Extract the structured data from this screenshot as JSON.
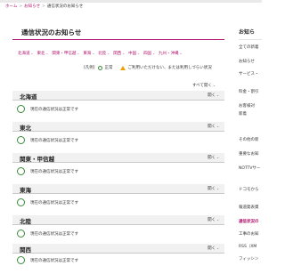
{
  "breadcrumb": {
    "home": "ホーム",
    "sep": ">",
    "parent": "お知らせ",
    "current": "通信状況のお知らせ"
  },
  "page_title": "通信状況のお知らせ",
  "region_tabs": [
    "北海道",
    "東北",
    "関東・甲信越",
    "東海",
    "北陸",
    "関西",
    "中国",
    "四国",
    "九州・沖縄"
  ],
  "legend": {
    "label": "[凡例]",
    "ok": "正常",
    "warn": "ご利用いただけない、または利用しづらい状況"
  },
  "open_all": "すべて開く",
  "regions": [
    {
      "name": "北海道",
      "toggle": "開く",
      "status": "現在の通信状況は正常です"
    },
    {
      "name": "東北",
      "toggle": "開く",
      "status": "現在の通信状況は正常です"
    },
    {
      "name": "関東・甲信越",
      "toggle": "開く",
      "status": "現在の通信状況は正常です"
    },
    {
      "name": "東海",
      "toggle": "開く",
      "status": "現在の通信状況は正常です"
    },
    {
      "name": "北陸",
      "toggle": "開く",
      "status": "現在の通信状況は正常です"
    },
    {
      "name": "関西",
      "toggle": "開く",
      "status": "現在の通信状況は正常です"
    }
  ],
  "sidebar": {
    "title": "お知ら",
    "items": [
      "全ての新着",
      "お知らせ",
      "サービス・",
      "料金・割引",
      "お客様対",
      "新着",
      "その他の新",
      "重要なお知",
      "NOTTVサー",
      "ドコモから",
      "報道発表資",
      "通信状況の",
      "工事のお知",
      "RSS（XM",
      "フィッシン"
    ],
    "active_index": 11
  },
  "colors": {
    "accent": "#b0126b",
    "ok": "#3a8b3a",
    "warn": "#f0a000"
  }
}
